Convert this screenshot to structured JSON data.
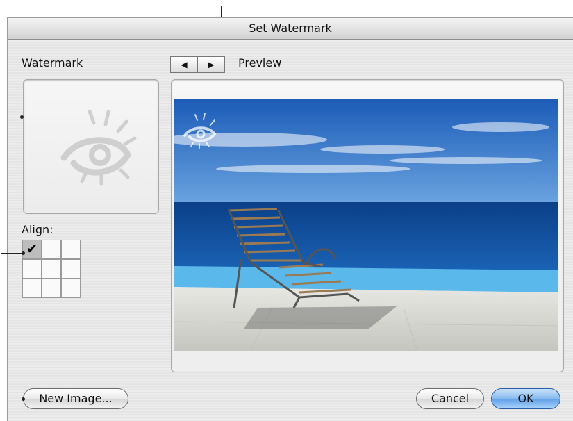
{
  "dialog": {
    "title": "Set Watermark"
  },
  "watermark": {
    "label": "Watermark"
  },
  "align": {
    "label": "Align:",
    "check": "✔",
    "cells": [
      "top-left",
      "top-center",
      "top-right",
      "middle-left",
      "middle-center",
      "middle-right",
      "bottom-left",
      "bottom-center",
      "bottom-right"
    ],
    "selected": "top-left"
  },
  "preview": {
    "label": "Preview",
    "prev_symbol": "◀",
    "next_symbol": "▶"
  },
  "buttons": {
    "new_image": "New Image...",
    "cancel": "Cancel",
    "ok": "OK"
  },
  "colors": {
    "sky": "#2f6ec8",
    "sea": "#0f4d9c",
    "pool": "#5ab8ea",
    "deck": "#d9d9d4",
    "accent": "#5f9fe6"
  }
}
